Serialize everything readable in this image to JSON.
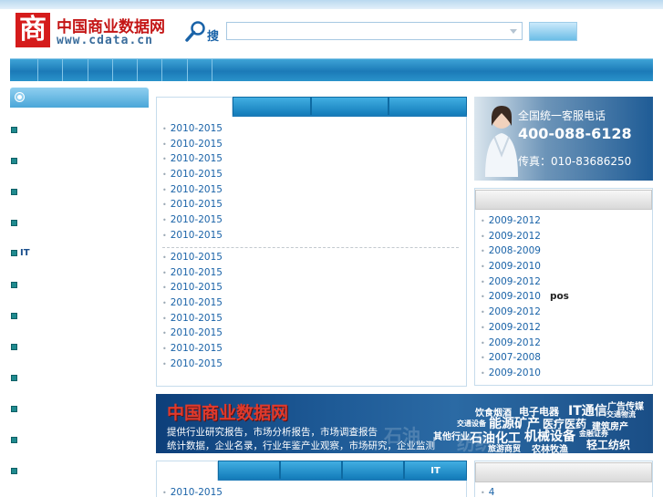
{
  "header": {
    "logo_mark": "商",
    "logo_name": "中国商业数据网",
    "logo_url": "www.cdata.cn",
    "search_label": "搜",
    "search_placeholder": ""
  },
  "sidebar": {
    "items": [
      {
        "label": ""
      },
      {
        "label": ""
      },
      {
        "label": ""
      },
      {
        "label": ""
      },
      {
        "label": "IT"
      },
      {
        "label": ""
      },
      {
        "label": ""
      },
      {
        "label": ""
      },
      {
        "label": ""
      },
      {
        "label": ""
      },
      {
        "label": ""
      },
      {
        "label": ""
      }
    ]
  },
  "center_panel": {
    "tabs": [
      {
        "label": ""
      },
      {
        "label": ""
      },
      {
        "label": ""
      },
      {
        "label": ""
      }
    ],
    "list_a": [
      "2010-2015",
      "2010-2015",
      "2010-2015",
      "2010-2015",
      "2010-2015",
      "2010-2015",
      "2010-2015",
      "2010-2015"
    ],
    "list_b": [
      "2010-2015",
      "2010-2015",
      "2010-2015",
      "2010-2015",
      "2010-2015",
      "2010-2015",
      "2010-2015",
      "2010-2015"
    ]
  },
  "ad": {
    "line1": "全国统一客服电话",
    "phone": "400-088-6128",
    "fax": "传真：010-83686250"
  },
  "right_list": [
    {
      "text": "2009-2012",
      "extra": ""
    },
    {
      "text": "2009-2012",
      "extra": ""
    },
    {
      "text": "2008-2009",
      "extra": ""
    },
    {
      "text": "2009-2010",
      "extra": ""
    },
    {
      "text": "2009-2012",
      "extra": ""
    },
    {
      "text": "2009-2010",
      "extra": "pos"
    },
    {
      "text": "2009-2012",
      "extra": ""
    },
    {
      "text": "2009-2012",
      "extra": ""
    },
    {
      "text": "2009-2012",
      "extra": ""
    },
    {
      "text": "2007-2008",
      "extra": ""
    },
    {
      "text": "2009-2010",
      "extra": ""
    }
  ],
  "banner": {
    "title": "中国商业数据网",
    "line1": "提供行业研究报告，市场分析报告，市场调查报告",
    "line2": "统计数据，企业名录，行业年鉴产业观察，市场研究，企业监测",
    "keywords": [
      "饮食烟酒",
      "电子电器",
      "IT通信",
      "广告传媒",
      "交通物流",
      "交通设备",
      "能源矿产",
      "医疗医药",
      "建筑房产",
      "金融证券",
      "其他行业",
      "石油化工",
      "机械设备",
      "轻工纺织",
      "旅游商贸",
      "农林牧渔"
    ]
  },
  "bottom_panel": {
    "tabs": [
      {
        "label": ""
      },
      {
        "label": ""
      },
      {
        "label": ""
      },
      {
        "label": ""
      },
      {
        "label": "IT"
      }
    ],
    "list": [
      "2010-2015"
    ]
  },
  "bottom_right": {
    "list": [
      "4"
    ]
  }
}
